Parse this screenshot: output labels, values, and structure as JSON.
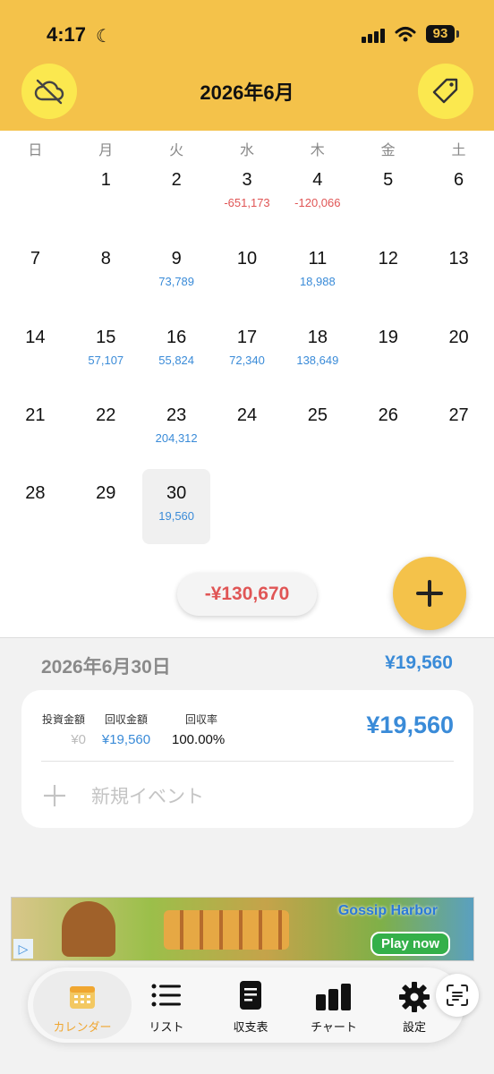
{
  "status_bar": {
    "time": "4:17",
    "battery": "93"
  },
  "header": {
    "title": "2026年6月",
    "left_icon": "cloud-off-icon",
    "right_icon": "tag-icon",
    "color": "#f4c24a"
  },
  "weekdays": [
    "日",
    "月",
    "火",
    "水",
    "木",
    "金",
    "土"
  ],
  "days": [
    {
      "day": "1",
      "amount": "",
      "sign": ""
    },
    {
      "day": "2",
      "amount": "",
      "sign": ""
    },
    {
      "day": "3",
      "amount": "-651,173",
      "sign": "neg"
    },
    {
      "day": "4",
      "amount": "-120,066",
      "sign": "neg"
    },
    {
      "day": "5",
      "amount": "",
      "sign": ""
    },
    {
      "day": "6",
      "amount": "",
      "sign": ""
    },
    {
      "day": "7",
      "amount": "",
      "sign": ""
    },
    {
      "day": "8",
      "amount": "",
      "sign": ""
    },
    {
      "day": "9",
      "amount": "73,789",
      "sign": "pos"
    },
    {
      "day": "10",
      "amount": "",
      "sign": ""
    },
    {
      "day": "11",
      "amount": "18,988",
      "sign": "pos"
    },
    {
      "day": "12",
      "amount": "",
      "sign": ""
    },
    {
      "day": "13",
      "amount": "",
      "sign": ""
    },
    {
      "day": "14",
      "amount": "",
      "sign": ""
    },
    {
      "day": "15",
      "amount": "57,107",
      "sign": "pos"
    },
    {
      "day": "16",
      "amount": "55,824",
      "sign": "pos"
    },
    {
      "day": "17",
      "amount": "72,340",
      "sign": "pos"
    },
    {
      "day": "18",
      "amount": "138,649",
      "sign": "pos"
    },
    {
      "day": "19",
      "amount": "",
      "sign": ""
    },
    {
      "day": "20",
      "amount": "",
      "sign": ""
    },
    {
      "day": "21",
      "amount": "",
      "sign": ""
    },
    {
      "day": "22",
      "amount": "",
      "sign": ""
    },
    {
      "day": "23",
      "amount": "204,312",
      "sign": "pos"
    },
    {
      "day": "24",
      "amount": "",
      "sign": ""
    },
    {
      "day": "25",
      "amount": "",
      "sign": ""
    },
    {
      "day": "26",
      "amount": "",
      "sign": ""
    },
    {
      "day": "27",
      "amount": "",
      "sign": ""
    },
    {
      "day": "28",
      "amount": "",
      "sign": ""
    },
    {
      "day": "29",
      "amount": "",
      "sign": ""
    },
    {
      "day": "30",
      "amount": "19,560",
      "sign": "pos",
      "selected": true
    }
  ],
  "month_total": "-¥130,670",
  "selected_day": {
    "date": "2026年6月30日",
    "total": "¥19,560",
    "stats": [
      {
        "label": "投資金額",
        "value": "¥0",
        "color": "#bbbbbb"
      },
      {
        "label": "回収金額",
        "value": "¥19,560",
        "color": "#3a8bd8"
      },
      {
        "label": "回収率",
        "value": "100.00%",
        "color": "#111111"
      }
    ],
    "card_amount": "¥19,560",
    "new_event_label": "新規イベント"
  },
  "ad": {
    "title": "Gossip Harbor",
    "cta": "Play now"
  },
  "nav": [
    {
      "label": "カレンダー",
      "icon": "calendar-icon",
      "active": true
    },
    {
      "label": "リスト",
      "icon": "list-icon",
      "active": false
    },
    {
      "label": "収支表",
      "icon": "document-icon",
      "active": false
    },
    {
      "label": "チャート",
      "icon": "bar-chart-icon",
      "active": false
    },
    {
      "label": "設定",
      "icon": "gear-icon",
      "active": false
    }
  ],
  "colors": {
    "positive": "#3a8bd8",
    "negative": "#e05555",
    "accent": "#f4c24a"
  }
}
